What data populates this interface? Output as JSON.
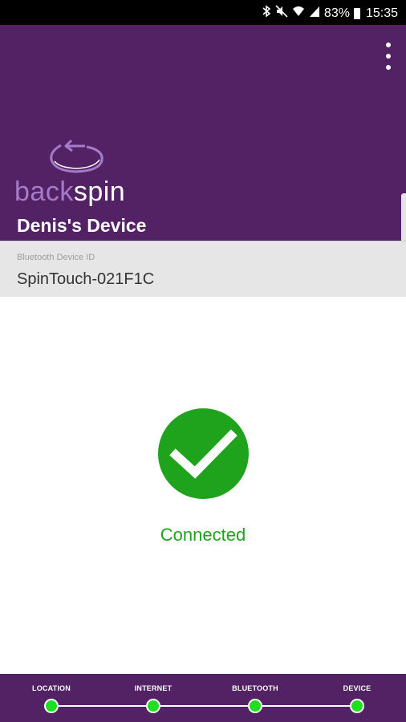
{
  "status_bar": {
    "battery_percent": "83%",
    "time": "15:35",
    "icons": [
      "bluetooth-icon",
      "mute-icon",
      "wifi-icon",
      "signal-icon",
      "battery-icon"
    ]
  },
  "header": {
    "logo": {
      "part1": "back",
      "part2": "spin"
    },
    "device_name": "Denis's Device",
    "menu_icon": "more-vertical-icon",
    "background_color": "#522265"
  },
  "device_info": {
    "label": "Bluetooth Device ID",
    "value": "SpinTouch-021F1C"
  },
  "status": {
    "icon": "check-circle-icon",
    "text": "Connected",
    "color": "#1fa21c"
  },
  "progress": {
    "steps": [
      {
        "label": "LOCATION",
        "complete": true
      },
      {
        "label": "INTERNET",
        "complete": true
      },
      {
        "label": "BLUETOOTH",
        "complete": true
      },
      {
        "label": "DEVICE",
        "complete": true
      }
    ]
  }
}
